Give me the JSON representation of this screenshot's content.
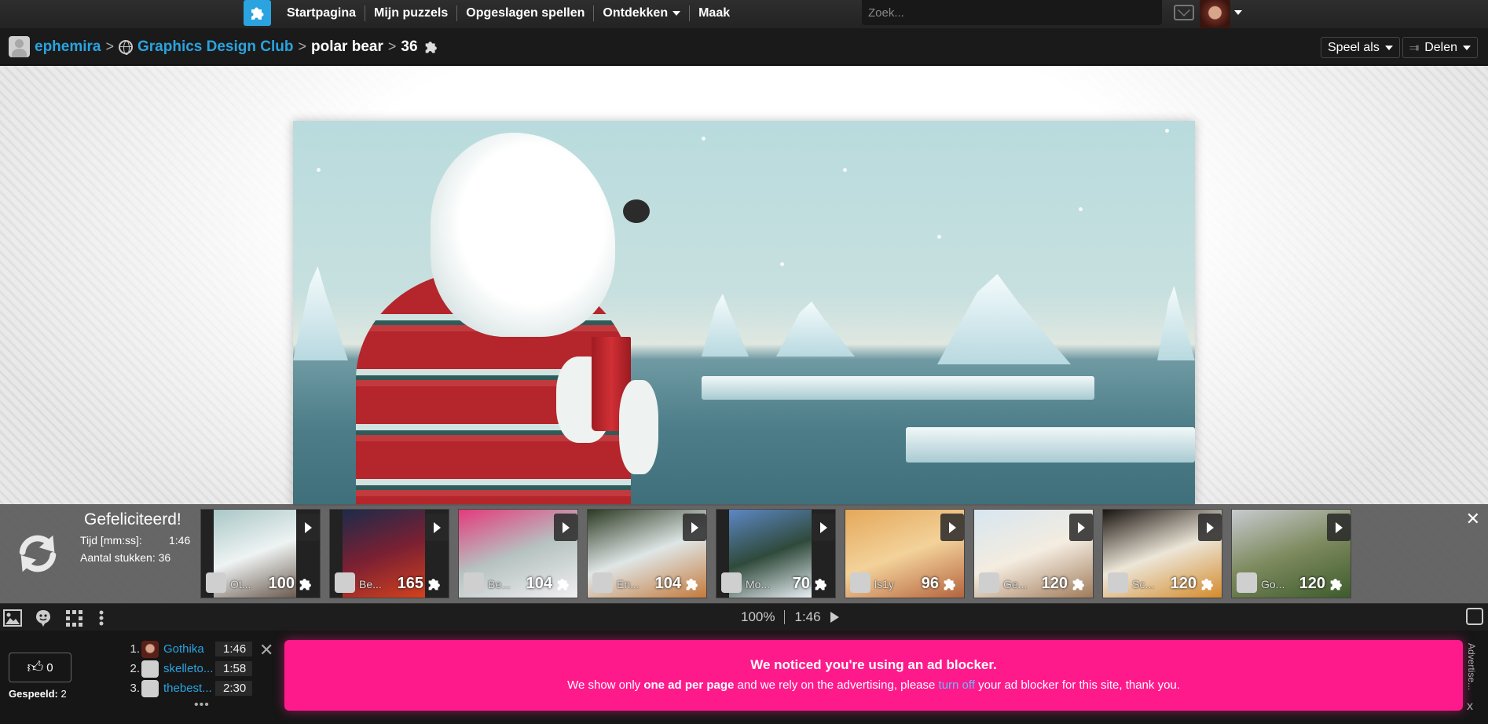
{
  "topnav": {
    "logo_icon": "puzzle-piece-icon",
    "items": [
      {
        "label": "Startpagina"
      },
      {
        "label": "Mijn puzzels"
      },
      {
        "label": "Opgeslagen spellen"
      },
      {
        "label": "Ontdekken",
        "has_dropdown": true
      },
      {
        "label": "Maak"
      }
    ],
    "search": {
      "placeholder": "Zoek...",
      "value": ""
    },
    "mail_icon": "mail-icon",
    "user_menu_icon": "caret-down-icon"
  },
  "breadcrumb": {
    "user": "ephemira",
    "group": "Graphics Design Club",
    "puzzle": "polar bear",
    "pieces": "36",
    "separator": ">"
  },
  "actions": {
    "play_as": "Speel als",
    "share": "Delen"
  },
  "completion": {
    "title": "Gefeliciteerd!",
    "time_label": "Tijd [mm:ss]:",
    "time_value": "1:46",
    "pieces_label": "Aantal stukken:",
    "pieces_value": "36",
    "suggestions": [
      {
        "owner": "Ot...",
        "pieces": "100",
        "colors": [
          "#a9c7c6",
          "#6b5a4e",
          "#eef3f3"
        ]
      },
      {
        "owner": "Be...",
        "pieces": "165",
        "colors": [
          "#1c2b4a",
          "#d3411d",
          "#7a2033"
        ]
      },
      {
        "owner": "Be...",
        "pieces": "104",
        "colors": [
          "#e43a7c",
          "#f0eef0",
          "#b6c3c1"
        ]
      },
      {
        "owner": "En...",
        "pieces": "104",
        "colors": [
          "#2c3a22",
          "#c47a3c",
          "#dfe6e6"
        ]
      },
      {
        "owner": "Mo...",
        "pieces": "70",
        "colors": [
          "#5d87c4",
          "#e8eef4",
          "#2f4a3b"
        ]
      },
      {
        "owner": "ls1y",
        "pieces": "96",
        "colors": [
          "#e4a85a",
          "#b5643d",
          "#f3d29a"
        ]
      },
      {
        "owner": "Ge...",
        "pieces": "120",
        "colors": [
          "#d7e6f0",
          "#a07b5a",
          "#f4ece0"
        ]
      },
      {
        "owner": "Sc...",
        "pieces": "120",
        "colors": [
          "#1a1410",
          "#d48b2c",
          "#ece6d8"
        ]
      },
      {
        "owner": "Go...",
        "pieces": "120",
        "colors": [
          "#c8cbd0",
          "#3d5b2c",
          "#7d8a5e"
        ]
      }
    ]
  },
  "toolbar": {
    "zoom": "100%",
    "timer": "1:46"
  },
  "bottom": {
    "likes": "0",
    "played_label": "Gespeeld:",
    "played_value": "2",
    "scores": [
      {
        "rank": "1.",
        "name": "Gothika",
        "time": "1:46"
      },
      {
        "rank": "2.",
        "name": "skelleto...",
        "time": "1:58"
      },
      {
        "rank": "3.",
        "name": "thebest...",
        "time": "2:30"
      }
    ],
    "more": "•••",
    "adblock": {
      "heading": "We noticed you're using an ad blocker.",
      "text_1": "We show only ",
      "text_bold": "one ad per page",
      "text_2": " and we rely on the advertising, please ",
      "link": "turn off",
      "text_3": " your ad blocker for this site, thank you.",
      "color": "#ff1a8c"
    },
    "ad_label": "Advertise...",
    "ad_close": "x"
  }
}
